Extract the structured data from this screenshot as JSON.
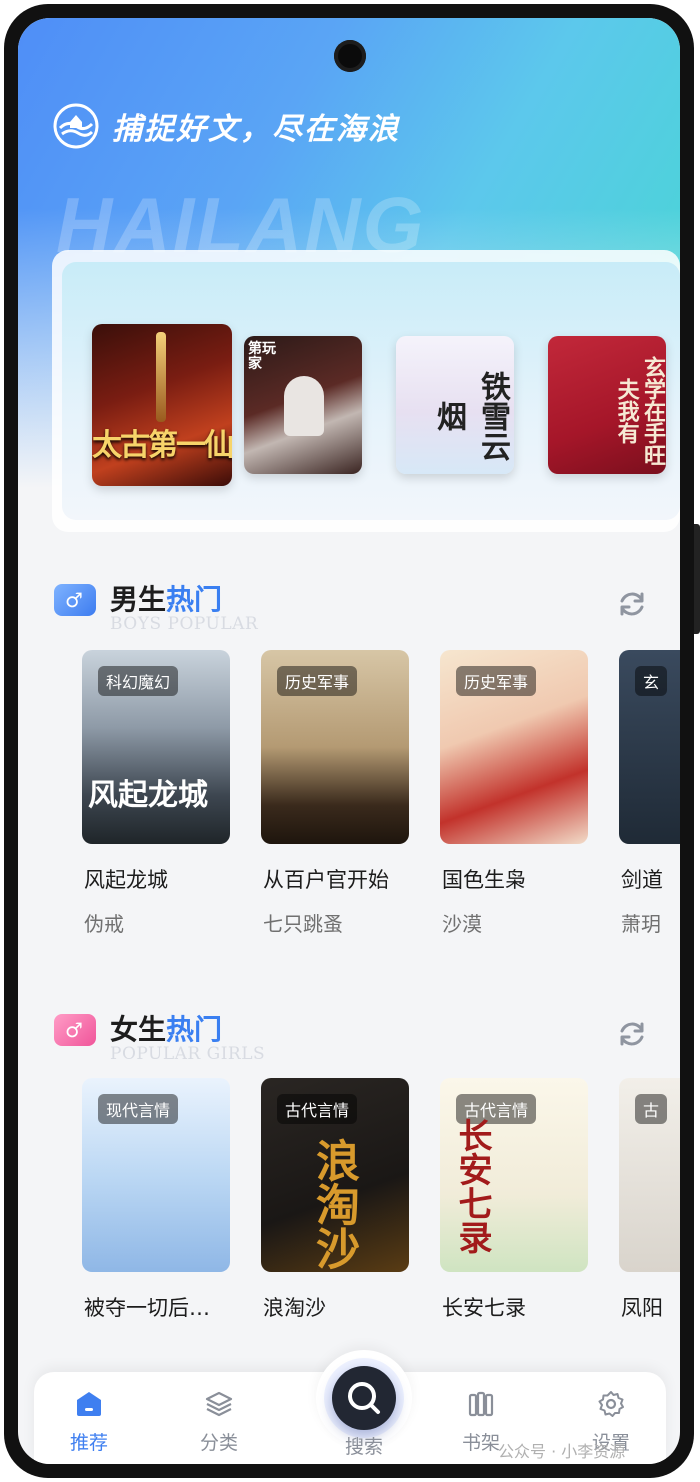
{
  "header": {
    "slogan": "捕捉好文，尽在海浪",
    "watermark": "HAILANG"
  },
  "banner": {
    "books": [
      {
        "title": "太古第一仙"
      },
      {
        "title": "第玩家"
      },
      {
        "title": "铁雪云烟"
      },
      {
        "title": "玄学在手旺夫我有"
      }
    ]
  },
  "boys": {
    "title_prefix": "男生",
    "title_hot": "热门",
    "subtitle": "BOYS POPULAR",
    "books": [
      {
        "tag": "科幻魔幻",
        "title": "风起龙城",
        "author": "伪戒"
      },
      {
        "tag": "历史军事",
        "title": "从百户官开始",
        "author": "七只跳蚤"
      },
      {
        "tag": "历史军事",
        "title": "国色生枭",
        "author": "沙漠"
      },
      {
        "tag": "玄",
        "title": "剑道",
        "author": "萧玥"
      }
    ]
  },
  "girls": {
    "title_prefix": "女生",
    "title_hot": "热门",
    "subtitle": "POPULAR GIRLS",
    "books": [
      {
        "tag": "现代言情",
        "title": "被夺一切后…"
      },
      {
        "tag": "古代言情",
        "title": "浪淘沙"
      },
      {
        "tag": "古代言情",
        "title": "长安七录"
      },
      {
        "tag": "古",
        "title": "凤阳"
      }
    ]
  },
  "tabbar": {
    "tabs": [
      {
        "label": "推荐",
        "icon": "home-icon"
      },
      {
        "label": "分类",
        "icon": "layers-icon"
      },
      {
        "label": "搜索",
        "icon": "search-icon"
      },
      {
        "label": "书架",
        "icon": "bookshelf-icon"
      },
      {
        "label": "设置",
        "icon": "gear-icon"
      }
    ],
    "active": "推荐"
  },
  "footer": {
    "watermark": "公众号 · 小李资源"
  },
  "colors": {
    "accent": "#3f7ff0",
    "hot_blue": "#3a7ff1",
    "boys_badge": "#4a8ff5",
    "girls_badge": "#f46aa8"
  }
}
